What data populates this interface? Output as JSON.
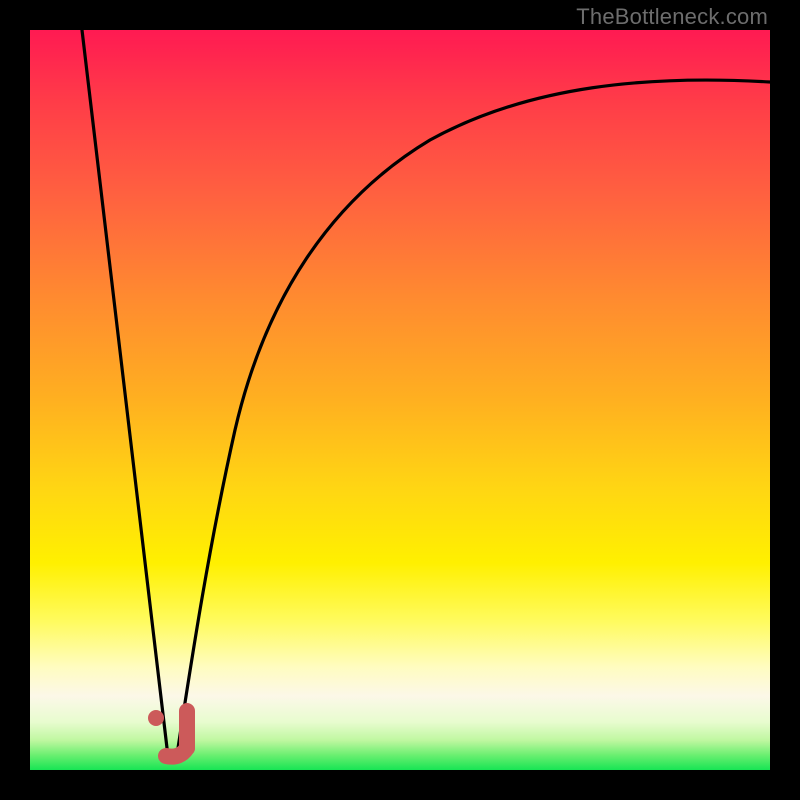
{
  "attribution": "TheBottleneck.com",
  "colors": {
    "frame": "#000000",
    "curve": "#000000",
    "marker": "#cc5a5a",
    "gradient_stops": [
      "#ff1a52",
      "#ff3d48",
      "#ff6040",
      "#ff8a30",
      "#ffb020",
      "#ffd613",
      "#fff000",
      "#fffb60",
      "#fffcbf",
      "#fcf8e8",
      "#e8fccf",
      "#bff7a0",
      "#6aef70",
      "#17e554"
    ]
  },
  "chart_data": {
    "type": "line",
    "title": "",
    "xlabel": "",
    "ylabel": "",
    "xlim": [
      0,
      100
    ],
    "ylim": [
      0,
      100
    ],
    "series": [
      {
        "name": "left-line",
        "x": [
          7,
          18.5
        ],
        "y": [
          100,
          3
        ]
      },
      {
        "name": "right-curve",
        "x": [
          20,
          22,
          25,
          28,
          32,
          38,
          45,
          55,
          70,
          85,
          100
        ],
        "y": [
          3,
          16,
          33,
          46,
          57,
          67,
          75,
          82,
          88,
          91.5,
          93
        ]
      }
    ],
    "marker": {
      "name": "j-marker",
      "approx_position": {
        "x": 19,
        "y": 5
      }
    }
  }
}
